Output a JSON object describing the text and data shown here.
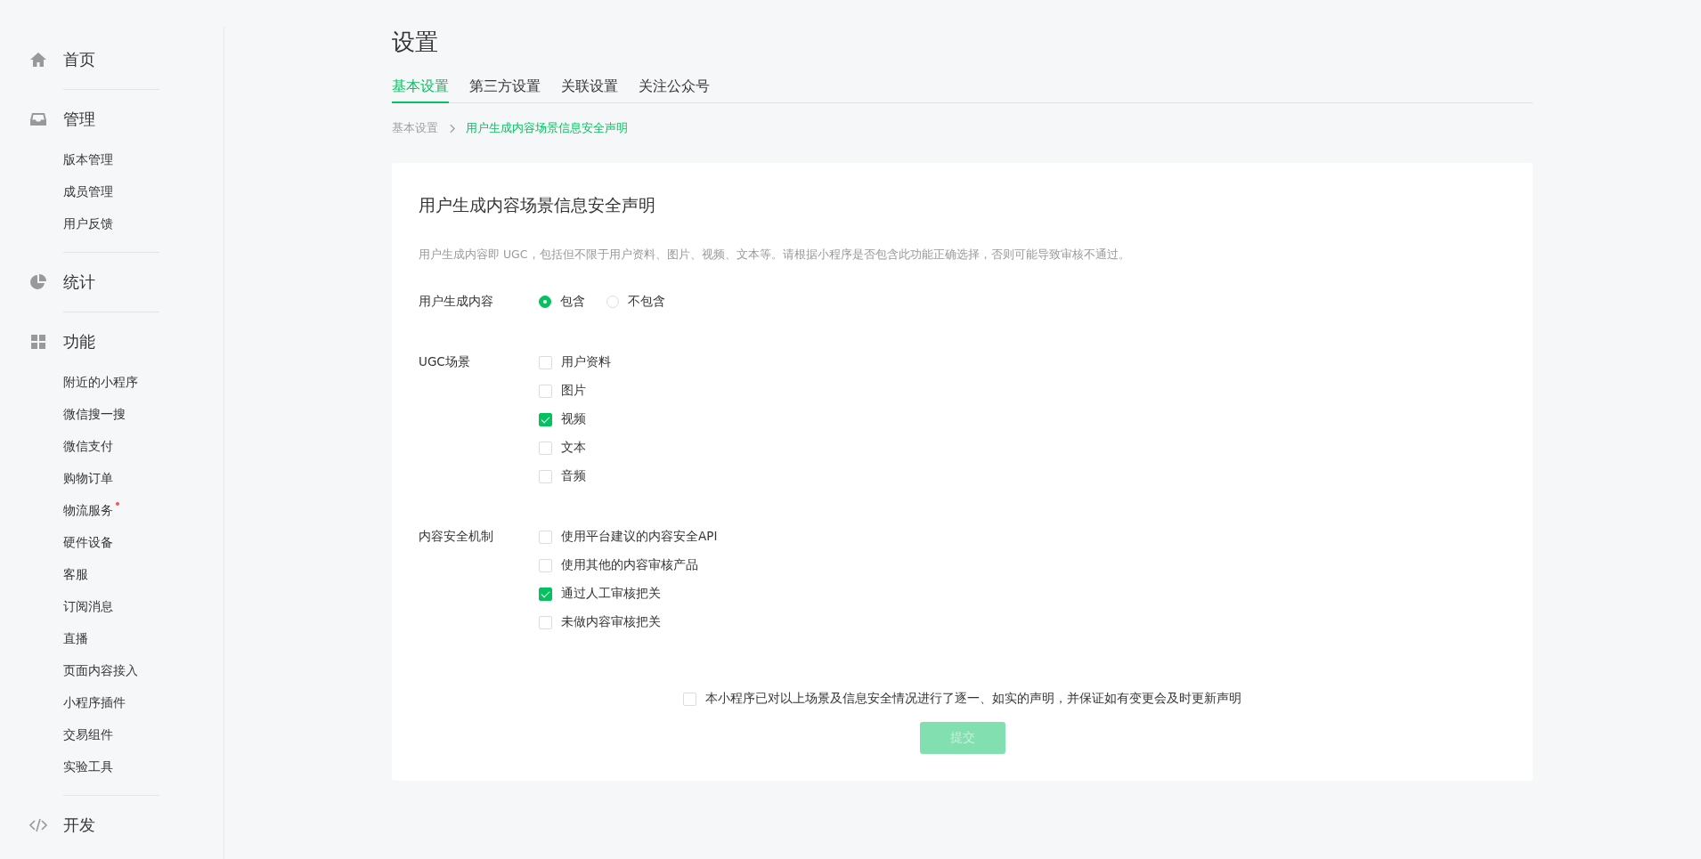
{
  "sidebar": {
    "groups": [
      {
        "label": "首页"
      },
      {
        "label": "管理",
        "items": [
          {
            "label": "版本管理",
            "dot": false
          },
          {
            "label": "成员管理",
            "dot": false
          },
          {
            "label": "用户反馈",
            "dot": false
          }
        ]
      },
      {
        "label": "统计"
      },
      {
        "label": "功能",
        "items": [
          {
            "label": "附近的小程序",
            "dot": false
          },
          {
            "label": "微信搜一搜",
            "dot": false
          },
          {
            "label": "微信支付",
            "dot": false
          },
          {
            "label": "购物订单",
            "dot": false
          },
          {
            "label": "物流服务",
            "dot": true
          },
          {
            "label": "硬件设备",
            "dot": false
          },
          {
            "label": "客服",
            "dot": false
          },
          {
            "label": "订阅消息",
            "dot": false
          },
          {
            "label": "直播",
            "dot": false
          },
          {
            "label": "页面内容接入",
            "dot": false
          },
          {
            "label": "小程序插件",
            "dot": false
          },
          {
            "label": "交易组件",
            "dot": false
          },
          {
            "label": "实验工具",
            "dot": false
          }
        ]
      },
      {
        "label": "开发"
      }
    ]
  },
  "page_title": "设置",
  "tabs": [
    {
      "label": "基本设置",
      "selected": true
    },
    {
      "label": "第三方设置",
      "selected": false
    },
    {
      "label": "关联设置",
      "selected": false
    },
    {
      "label": "关注公众号",
      "selected": false
    }
  ],
  "breadcrumb": [
    "基本设置",
    "用户生成内容场景信息安全声明"
  ],
  "card": {
    "title": "用户生成内容场景信息安全声明",
    "description": "用户生成内容即 UGC，包括但不限于用户资料、图片、视频、文本等。请根据小程序是否包含此功能正确选择，否则可能导致审核不通过。",
    "fields": [
      {
        "kind": "radio",
        "label": "用户生成内容",
        "options": [
          {
            "label": "包含",
            "selected": true
          },
          {
            "label": "不包含",
            "selected": false
          }
        ]
      },
      {
        "kind": "checkbox",
        "label": "UGC场景",
        "options": [
          {
            "label": "用户资料",
            "checked": false
          },
          {
            "label": "图片",
            "checked": false
          },
          {
            "label": "视频",
            "checked": true
          },
          {
            "label": "文本",
            "checked": false
          },
          {
            "label": "音频",
            "checked": false
          }
        ]
      },
      {
        "kind": "checkbox",
        "label": "内容安全机制",
        "options": [
          {
            "label": "使用平台建议的内容安全API",
            "checked": false
          },
          {
            "label": "使用其他的内容审核产品",
            "checked": false
          },
          {
            "label": "通过人工审核把关",
            "checked": true
          },
          {
            "label": "未做内容审核把关",
            "checked": false
          }
        ]
      }
    ],
    "declaration": {
      "label": "本小程序已对以上场景及信息安全情况进行了逐一、如实的声明，并保证如有变更会及时更新声明",
      "checked": false
    },
    "submit": {
      "label": "提交",
      "disabled": true
    }
  }
}
